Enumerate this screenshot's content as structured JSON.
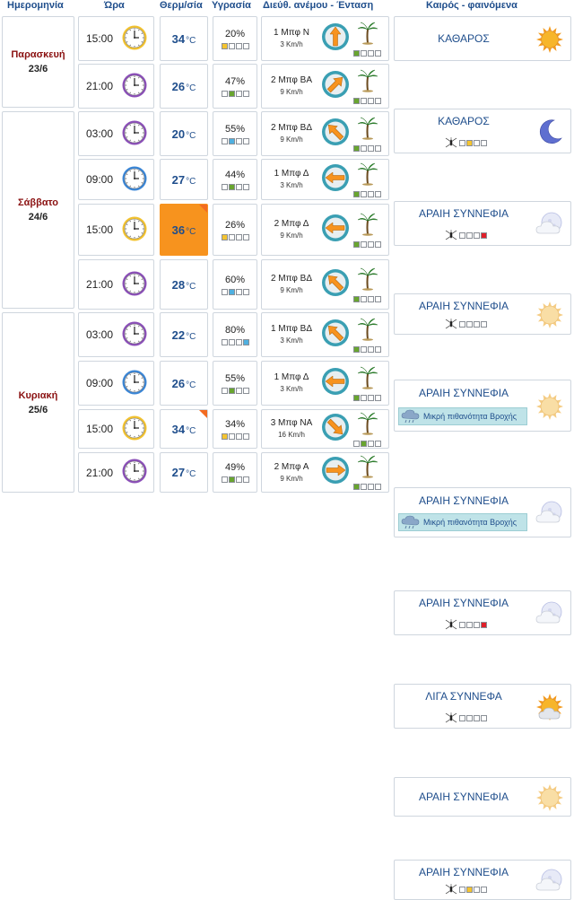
{
  "headers": {
    "date": "Ημερομηνία",
    "time": "Ώρα",
    "temp": "Θερμ/σία",
    "humidity": "Υγρασία",
    "wind": "Διεύθ. ανέμου - Ένταση",
    "weather": "Καιρός - φαινόμενα"
  },
  "temp_unit": "°C",
  "days": [
    {
      "name": "Παρασκευή",
      "date": "23/6"
    },
    {
      "name": "Σάββατο",
      "date": "24/6"
    },
    {
      "name": "Κυριακή",
      "date": "25/6"
    }
  ],
  "rows": [
    {
      "time": "15:00",
      "clock": "yellow",
      "temp": "34",
      "hot": false,
      "flag": false,
      "hum": "20%",
      "hum_level": 1,
      "wind": "1 Μπφ Ν",
      "speed": "3 Km/h",
      "dir": "N",
      "wind_level": 1,
      "sky": "ΚΑΘΑΡΟΣ",
      "icon": "sun",
      "mosq": false,
      "rain": ""
    },
    {
      "time": "21:00",
      "clock": "purple",
      "temp": "26",
      "hot": false,
      "flag": false,
      "hum": "47%",
      "hum_level": 2,
      "wind": "2 Μπφ ΒΑ",
      "speed": "9 Km/h",
      "dir": "NE",
      "wind_level": 1,
      "sky": "ΚΑΘΑΡΟΣ",
      "icon": "moon",
      "mosq": true,
      "mosq_level": 2,
      "rain": ""
    },
    {
      "time": "03:00",
      "clock": "purple",
      "temp": "20",
      "hot": false,
      "flag": false,
      "hum": "55%",
      "hum_level": 2,
      "wind": "2 Μπφ ΒΔ",
      "speed": "9 Km/h",
      "dir": "NW",
      "wind_level": 1,
      "sky": "ΑΡΑΙΗ ΣΥΝΝΕΦΙΑ",
      "icon": "moon-cloud",
      "mosq": true,
      "mosq_level": 4,
      "rain": ""
    },
    {
      "time": "09:00",
      "clock": "blue",
      "temp": "27",
      "hot": false,
      "flag": false,
      "hum": "44%",
      "hum_level": 2,
      "wind": "1 Μπφ Δ",
      "speed": "3 Km/h",
      "dir": "W",
      "wind_level": 1,
      "sky": "ΑΡΑΙΗ ΣΥΝΝΕΦΙΑ",
      "icon": "sun-cloud",
      "mosq": true,
      "mosq_level": 0,
      "rain": ""
    },
    {
      "time": "15:00",
      "clock": "yellow",
      "temp": "36",
      "hot": true,
      "flag": true,
      "hum": "26%",
      "hum_level": 1,
      "wind": "2 Μπφ Δ",
      "speed": "9 Km/h",
      "dir": "W",
      "wind_level": 1,
      "sky": "ΑΡΑΙΗ ΣΥΝΝΕΦΙΑ",
      "icon": "sun-cloud",
      "mosq": false,
      "rain": "Μικρή πιθανότητα Βροχής"
    },
    {
      "time": "21:00",
      "clock": "purple",
      "temp": "28",
      "hot": false,
      "flag": false,
      "hum": "60%",
      "hum_level": 2,
      "wind": "2 Μπφ ΒΔ",
      "speed": "9 Km/h",
      "dir": "NW",
      "wind_level": 1,
      "sky": "ΑΡΑΙΗ ΣΥΝΝΕΦΙΑ",
      "icon": "moon-cloud",
      "mosq": false,
      "rain": "Μικρή πιθανότητα Βροχής"
    },
    {
      "time": "03:00",
      "clock": "purple",
      "temp": "22",
      "hot": false,
      "flag": false,
      "hum": "80%",
      "hum_level": 4,
      "wind": "1 Μπφ ΒΔ",
      "speed": "3 Km/h",
      "dir": "NW",
      "wind_level": 1,
      "sky": "ΑΡΑΙΗ ΣΥΝΝΕΦΙΑ",
      "icon": "moon-cloud",
      "mosq": true,
      "mosq_level": 4,
      "rain": ""
    },
    {
      "time": "09:00",
      "clock": "blue",
      "temp": "26",
      "hot": false,
      "flag": false,
      "hum": "55%",
      "hum_level": 2,
      "wind": "1 Μπφ Δ",
      "speed": "3 Km/h",
      "dir": "W",
      "wind_level": 1,
      "sky": "ΛΙΓΑ ΣΥΝΝΕΦΑ",
      "icon": "sun-cloud2",
      "mosq": true,
      "mosq_level": 0,
      "rain": ""
    },
    {
      "time": "15:00",
      "clock": "yellow",
      "temp": "34",
      "hot": false,
      "flag": true,
      "hum": "34%",
      "hum_level": 1,
      "wind": "3 Μπφ ΝΑ",
      "speed": "16 Km/h",
      "dir": "SE",
      "wind_level": 2,
      "sky": "ΑΡΑΙΗ ΣΥΝΝΕΦΙΑ",
      "icon": "sun-cloud",
      "mosq": false,
      "rain": ""
    },
    {
      "time": "21:00",
      "clock": "purple",
      "temp": "27",
      "hot": false,
      "flag": false,
      "hum": "49%",
      "hum_level": 2,
      "wind": "2 Μπφ Α",
      "speed": "9 Km/h",
      "dir": "E",
      "wind_level": 1,
      "sky": "ΑΡΑΙΗ ΣΥΝΝΕΦΙΑ",
      "icon": "moon-cloud",
      "mosq": true,
      "mosq_level": 2,
      "rain": ""
    }
  ],
  "colors": {
    "header_text": "#1f4e8c",
    "day_name": "#8a1010",
    "hot_cell": "#f7931e",
    "flag": "#f36b21",
    "wind_arrow": "#f7931e",
    "compass_ring": "#3a9fb3",
    "level_green": "#69a52f",
    "level_blue": "#4fb0e0",
    "level_yellow": "#f4c430",
    "level_red": "#e0202a",
    "rain_box": "#bfe3e8"
  }
}
